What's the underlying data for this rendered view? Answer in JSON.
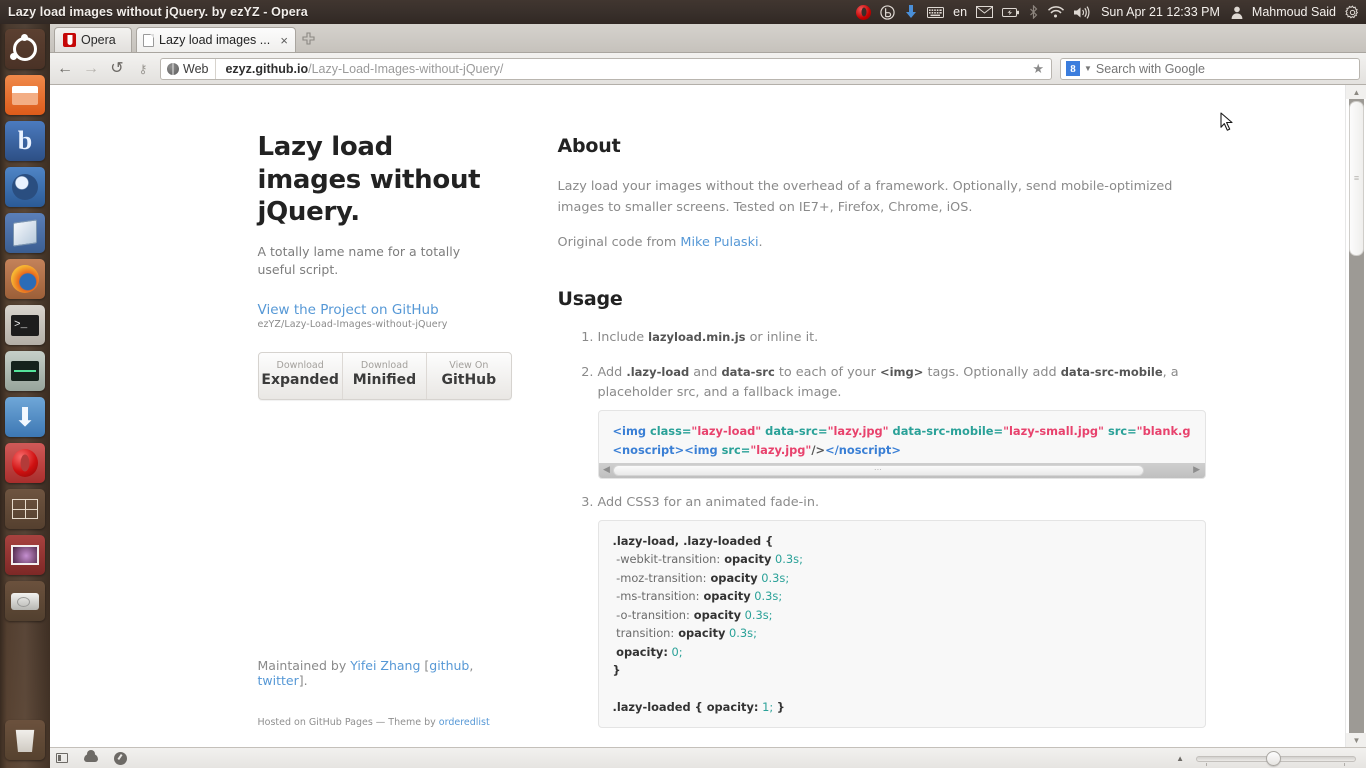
{
  "window": {
    "title": "Lazy load images without jQuery. by ezYZ - Opera"
  },
  "tray": {
    "keyboard_layout": "en",
    "clock": "Sun Apr 21 12:33 PM",
    "user": "Mahmoud Said",
    "icons": [
      "opera-icon",
      "baidu-icon",
      "download-arrow-icon",
      "keyboard-icon",
      "mail-icon",
      "battery-icon",
      "bluetooth-icon",
      "wifi-icon",
      "volume-icon",
      "user-icon",
      "gear-icon"
    ]
  },
  "launcher": {
    "items": [
      {
        "name": "ubuntu-dash",
        "label": "Ubuntu"
      },
      {
        "name": "files",
        "label": "Files"
      },
      {
        "name": "baidu",
        "label": "Baidu"
      },
      {
        "name": "bird-app",
        "label": "App"
      },
      {
        "name": "virtualbox",
        "label": "VirtualBox"
      },
      {
        "name": "firefox",
        "label": "Firefox"
      },
      {
        "name": "terminal",
        "label": "Terminal"
      },
      {
        "name": "system-monitor",
        "label": "System Monitor"
      },
      {
        "name": "download-manager",
        "label": "Downloads"
      },
      {
        "name": "opera",
        "label": "Opera"
      },
      {
        "name": "workspace-switcher",
        "label": "Workspaces"
      },
      {
        "name": "image-viewer",
        "label": "Image Viewer"
      },
      {
        "name": "disk",
        "label": "Disk"
      },
      {
        "name": "trash",
        "label": "Trash"
      }
    ]
  },
  "browser": {
    "menu_button_label": "Opera",
    "tab": {
      "title": "Lazy load images ...",
      "close_label": "×"
    },
    "new_tab_label": "✚",
    "nav": {
      "back": "←",
      "forward": "→",
      "reload": "↺",
      "key": "⚷"
    },
    "url": {
      "badge_label": "Web",
      "domain": "ezyz.github.io",
      "path": "/Lazy-Load-Images-without-jQuery/",
      "star": "★"
    },
    "search": {
      "engine_badge": "8",
      "placeholder": "Search with Google"
    },
    "statusbar": {
      "icons": [
        "panel-toggle-icon",
        "cloud-icon",
        "gauge-icon"
      ],
      "zoom_caret": "▲"
    }
  },
  "page": {
    "left": {
      "title": "Lazy load images without jQuery.",
      "tagline": "A totally lame name for a totally useful script.",
      "view_project_label": "View the Project on GitHub",
      "repo_path": "ezYZ/Lazy-Load-Images-without-jQuery",
      "buttons": [
        {
          "top": "Download",
          "bottom": "Expanded"
        },
        {
          "top": "Download",
          "bottom": "Minified"
        },
        {
          "top": "View On",
          "bottom": "GitHub"
        }
      ],
      "maintained_prefix": "Maintained by ",
      "maintained_name": "Yifei Zhang",
      "maintained_bracket_open": " [",
      "maintained_github": "github",
      "maintained_sep": ", ",
      "maintained_twitter": "twitter",
      "maintained_bracket_close": "].",
      "hosted_prefix": "Hosted on GitHub Pages — Theme by ",
      "hosted_theme": "orderedlist"
    },
    "right": {
      "about_heading": "About",
      "about_p1": "Lazy load your images without the overhead of a framework. Optionally, send mobile-optimized images to smaller screens. Tested on IE7+, Firefox, Chrome, iOS.",
      "about_p2_prefix": "Original code from ",
      "about_p2_link": "Mike Pulaski",
      "about_p2_suffix": ".",
      "usage_heading": "Usage",
      "step1_a": "Include ",
      "step1_code": "lazyload.min.js",
      "step1_b": " or inline it.",
      "step2_a": "Add ",
      "step2_code1": ".lazy-load",
      "step2_b": " and ",
      "step2_code2": "data-src",
      "step2_c": " to each of your ",
      "step2_code3": "<img>",
      "step2_d": " tags. Optionally add ",
      "step2_code4": "data-src-mobile",
      "step2_e": ", a placeholder src, and a fallback image.",
      "step3": "Add CSS3 for an animated fade-in.",
      "html_code": {
        "line1": {
          "tag_open": "<img",
          "attr_class": " class=",
          "val_class": "\"lazy-load\"",
          "attr_datasrc": " data-src=",
          "val_datasrc": "\"lazy.jpg\"",
          "attr_mobile": " data-src-mobile=",
          "val_mobile": "\"lazy-small.jpg\"",
          "attr_src": " src=",
          "val_src": "\"blank.g"
        },
        "line2": {
          "ns_open": "<noscript>",
          "img_open": "<img",
          "attr_src": " src=",
          "val_src": "\"lazy.jpg\"",
          "img_close": "/>",
          "ns_close": "</noscript>"
        }
      },
      "css_code": [
        {
          "sel": ".lazy-load, .lazy-loaded",
          "brace": " {"
        },
        {
          "prop": "-webkit-transition:",
          "propb": " opacity",
          "val": " 0.3s;"
        },
        {
          "prop": "-moz-transition:",
          "propb": " opacity",
          "val": " 0.3s;"
        },
        {
          "prop": "-ms-transition:",
          "propb": " opacity",
          "val": " 0.3s;"
        },
        {
          "prop": "-o-transition:",
          "propb": " opacity",
          "val": " 0.3s;"
        },
        {
          "prop": "transition:",
          "propb": " opacity",
          "val": " 0.3s;"
        },
        {
          "propb2": "opacity:",
          "val": " 0;"
        },
        {
          "close": "}"
        },
        {
          "blank": ""
        },
        {
          "sel2": ".lazy-loaded { ",
          "propb3": "opacity:",
          "val2": " 1; ",
          "close2": "}"
        }
      ]
    }
  }
}
